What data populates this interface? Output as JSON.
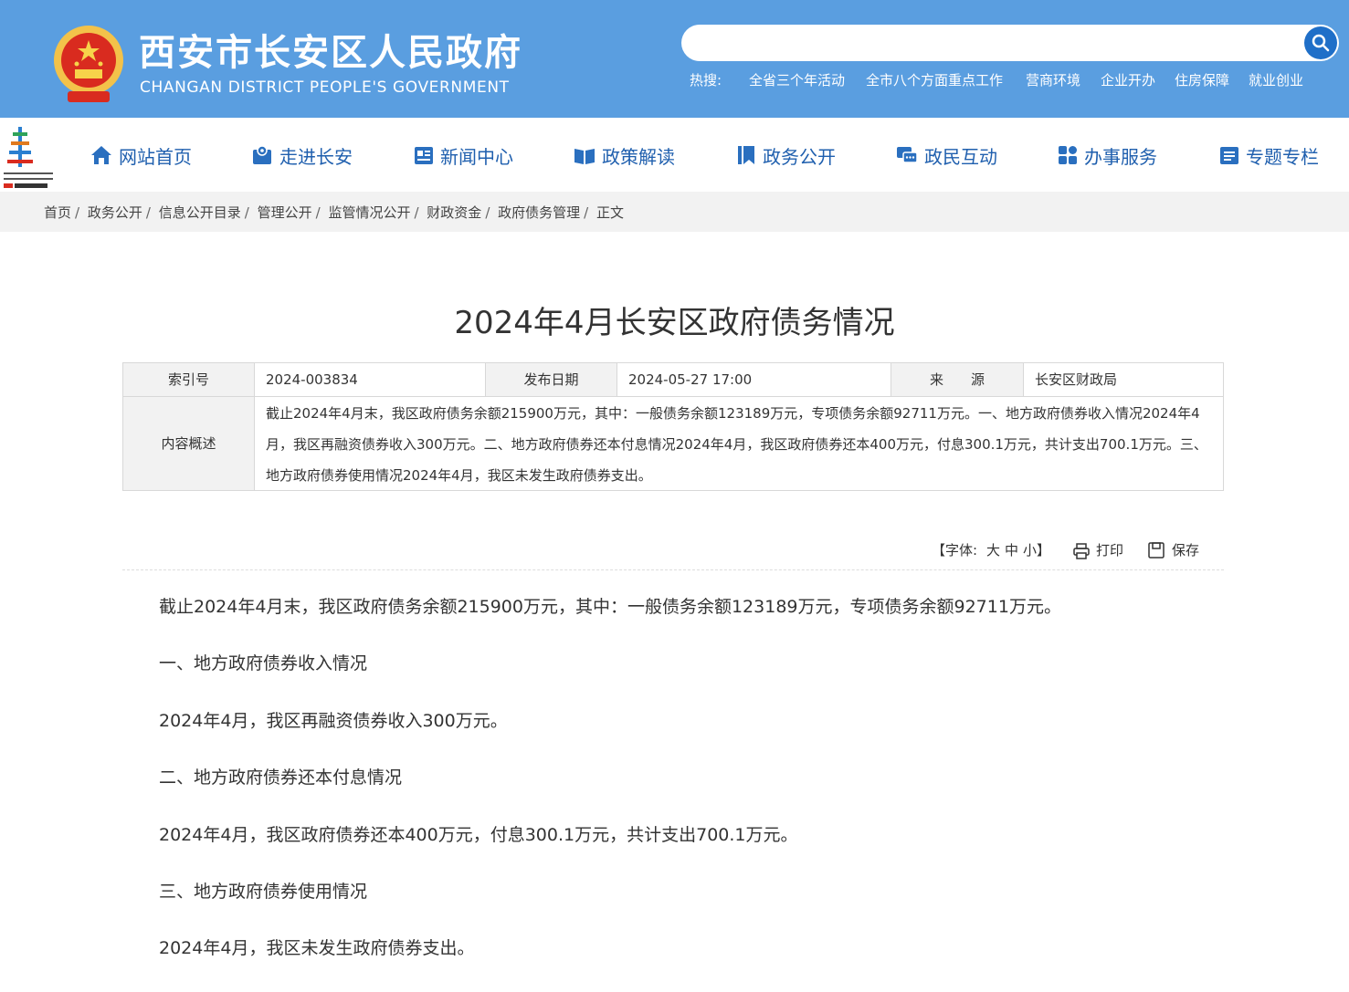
{
  "header": {
    "title": "西安市长安区人民政府",
    "subtitle": "CHANGAN DISTRICT PEOPLE'S GOVERNMENT",
    "search": {
      "placeholder": ""
    },
    "hot_label": "热搜:",
    "hot_links": [
      "全省三个年活动",
      "全市八个方面重点工作",
      "营商环境",
      "企业开办",
      "住房保障",
      "就业创业"
    ]
  },
  "nav": {
    "items": [
      {
        "label": "网站首页",
        "icon": "home-icon"
      },
      {
        "label": "走进长安",
        "icon": "map-icon"
      },
      {
        "label": "新闻中心",
        "icon": "news-icon"
      },
      {
        "label": "政策解读",
        "icon": "book-icon"
      },
      {
        "label": "政务公开",
        "icon": "bookmark-icon"
      },
      {
        "label": "政民互动",
        "icon": "chat-icon"
      },
      {
        "label": "办事服务",
        "icon": "grid-icon"
      },
      {
        "label": "专题专栏",
        "icon": "list-icon"
      }
    ]
  },
  "breadcrumb": {
    "items": [
      "首页",
      "政务公开",
      "信息公开目录",
      "管理公开",
      "监管情况公开",
      "财政资金",
      "政府债务管理",
      "正文"
    ]
  },
  "article": {
    "title": "2024年4月长安区政府债务情况",
    "meta": {
      "index_label": "索引号",
      "index_value": "2024-003834",
      "date_label": "发布日期",
      "date_value": "2024-05-27 17:00",
      "source_label": "来　　源",
      "source_value": "长安区财政局",
      "summary_label": "内容概述",
      "summary_value": "截止2024年4月末，我区政府债务余额215900万元，其中：一般债务余额123189万元，专项债务余额92711万元。一、地方政府债券收入情况2024年4月，我区再融资债券收入300万元。二、地方政府债券还本付息情况2024年4月，我区政府债券还本400万元，付息300.1万元，共计支出700.1万元。三、地方政府债券使用情况2024年4月，我区未发生政府债券支出。"
    },
    "tools": {
      "font_label": "【字体:",
      "font_large": "大",
      "font_medium": "中",
      "font_small": "小】",
      "print_label": "打印",
      "save_label": "保存"
    },
    "paragraphs": [
      "截止2024年4月末，我区政府债务余额215900万元，其中：一般债务余额123189万元，专项债务余额92711万元。",
      "一、地方政府债券收入情况",
      "2024年4月，我区再融资债券收入300万元。",
      "二、地方政府债券还本付息情况",
      "2024年4月，我区政府债券还本400万元，付息300.1万元，共计支出700.1万元。",
      "三、地方政府债券使用情况",
      "2024年4月，我区未发生政府债券支出。"
    ]
  },
  "colors": {
    "header_bg": "#5a9ee0",
    "nav_text": "#1f5fae",
    "search_btn": "#1f6fc8"
  }
}
